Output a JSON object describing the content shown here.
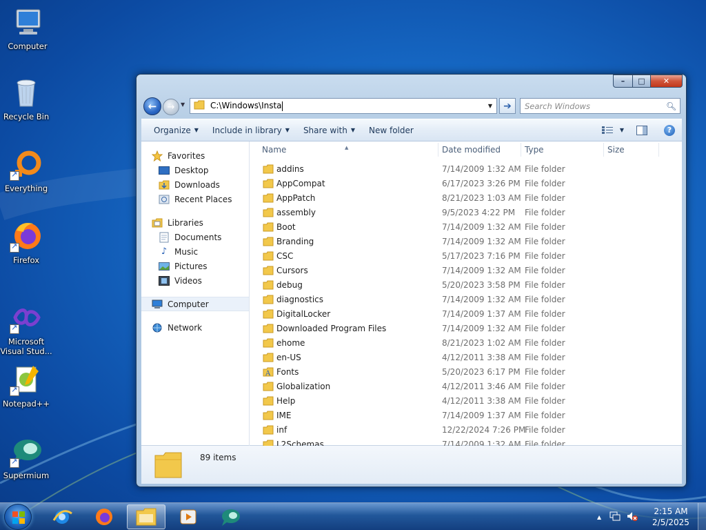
{
  "desktop": {
    "icons": [
      {
        "label": "Computer"
      },
      {
        "label": "Recycle Bin"
      },
      {
        "label": "Everything"
      },
      {
        "label": "Firefox"
      },
      {
        "label": "Microsoft Visual Stud..."
      },
      {
        "label": "Notepad++"
      },
      {
        "label": "Supermium"
      }
    ]
  },
  "window": {
    "controls": {
      "minimize": "–",
      "maximize": "□",
      "close": "✕"
    },
    "address": {
      "path": "C:\\Windows\\Insta"
    },
    "search": {
      "placeholder": "Search Windows"
    },
    "toolbar": {
      "organize": "Organize",
      "include_in_library": "Include in library",
      "share_with": "Share with",
      "new_folder": "New folder"
    },
    "nav_pane": {
      "favorites": "Favorites",
      "favorites_items": [
        "Desktop",
        "Downloads",
        "Recent Places"
      ],
      "libraries": "Libraries",
      "libraries_items": [
        "Documents",
        "Music",
        "Pictures",
        "Videos"
      ],
      "computer": "Computer",
      "network": "Network"
    },
    "columns": {
      "name": "Name",
      "date_modified": "Date modified",
      "type": "Type",
      "size": "Size"
    },
    "files": [
      {
        "name": "addins",
        "date": "7/14/2009 1:32 AM",
        "type": "File folder"
      },
      {
        "name": "AppCompat",
        "date": "6/17/2023 3:26 PM",
        "type": "File folder"
      },
      {
        "name": "AppPatch",
        "date": "8/21/2023 1:03 AM",
        "type": "File folder"
      },
      {
        "name": "assembly",
        "date": "9/5/2023 4:22 PM",
        "type": "File folder"
      },
      {
        "name": "Boot",
        "date": "7/14/2009 1:32 AM",
        "type": "File folder"
      },
      {
        "name": "Branding",
        "date": "7/14/2009 1:32 AM",
        "type": "File folder"
      },
      {
        "name": "CSC",
        "date": "5/17/2023 7:16 PM",
        "type": "File folder"
      },
      {
        "name": "Cursors",
        "date": "7/14/2009 1:32 AM",
        "type": "File folder"
      },
      {
        "name": "debug",
        "date": "5/20/2023 3:58 PM",
        "type": "File folder"
      },
      {
        "name": "diagnostics",
        "date": "7/14/2009 1:32 AM",
        "type": "File folder"
      },
      {
        "name": "DigitalLocker",
        "date": "7/14/2009 1:37 AM",
        "type": "File folder"
      },
      {
        "name": "Downloaded Program Files",
        "date": "7/14/2009 1:32 AM",
        "type": "File folder"
      },
      {
        "name": "ehome",
        "date": "8/21/2023 1:02 AM",
        "type": "File folder"
      },
      {
        "name": "en-US",
        "date": "4/12/2011 3:38 AM",
        "type": "File folder"
      },
      {
        "name": "Fonts",
        "date": "5/20/2023 6:17 PM",
        "type": "File folder"
      },
      {
        "name": "Globalization",
        "date": "4/12/2011 3:46 AM",
        "type": "File folder"
      },
      {
        "name": "Help",
        "date": "4/12/2011 3:38 AM",
        "type": "File folder"
      },
      {
        "name": "IME",
        "date": "7/14/2009 1:37 AM",
        "type": "File folder"
      },
      {
        "name": "inf",
        "date": "12/22/2024 7:26 PM",
        "type": "File folder"
      },
      {
        "name": "L2Schemas",
        "date": "7/14/2009 1:32 AM",
        "type": "File folder"
      }
    ],
    "status": {
      "count": "89 items"
    }
  },
  "taskbar": {
    "apps": [
      "internet-explorer-icon",
      "firefox-icon",
      "file-explorer-icon",
      "media-player-icon",
      "supermium-icon"
    ],
    "clock": {
      "time": "2:15 AM",
      "date": "2/5/2025"
    }
  },
  "colors": {
    "folder": "#f2c84b",
    "accent": "#1d5fb8",
    "close": "#c2381b"
  }
}
